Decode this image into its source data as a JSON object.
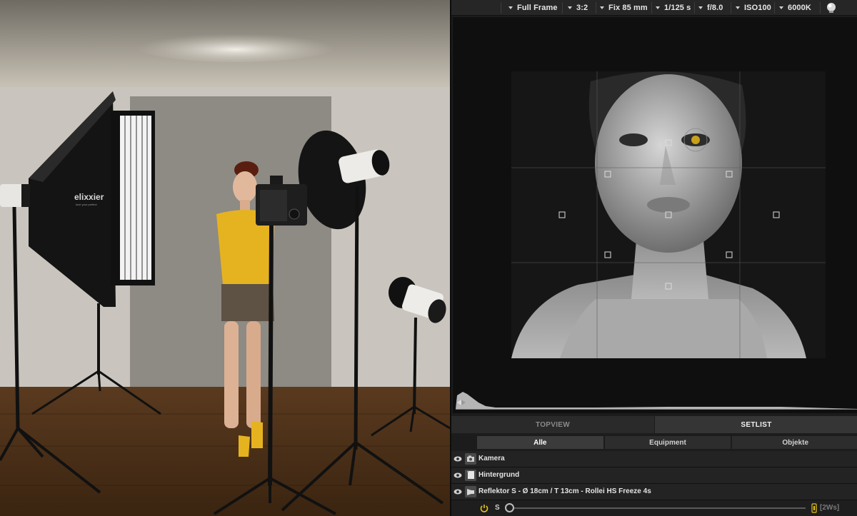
{
  "camera_bar": {
    "sensor": "Full Frame",
    "aspect": "3:2",
    "lens": "Fix 85 mm",
    "shutter": "1/125 s",
    "aperture": "f/8.0",
    "iso": "ISO100",
    "white_balance": "6000K",
    "light_icon": "light-bulb-icon"
  },
  "studio_scene": {
    "softbox_brand": "elixxier",
    "softbox_slogan": "love your perfect"
  },
  "view_tabs": {
    "items": [
      {
        "label": "TOPVIEW",
        "active": false
      },
      {
        "label": "SETLIST",
        "active": true
      }
    ]
  },
  "filters": {
    "items": [
      {
        "label": "Alle",
        "active": true
      },
      {
        "label": "Equipment",
        "active": false
      },
      {
        "label": "Objekte",
        "active": false
      }
    ]
  },
  "setlist": {
    "items": [
      {
        "label": "Kamera",
        "icon": "camera-icon"
      },
      {
        "label": "Hintergrund",
        "icon": "background-icon"
      },
      {
        "label": "Reflektor S - Ø 18cm / T 13cm - Rollei HS Freeze 4s",
        "icon": "reflector-icon"
      }
    ],
    "power_row": {
      "s_label": "S",
      "power_value": "[2Ws]",
      "slider_level": 0.0
    }
  },
  "colors": {
    "panel_bg": "#1c1c1c",
    "accent_yellow": "#e8c21a",
    "text": "#e4e4e4"
  }
}
